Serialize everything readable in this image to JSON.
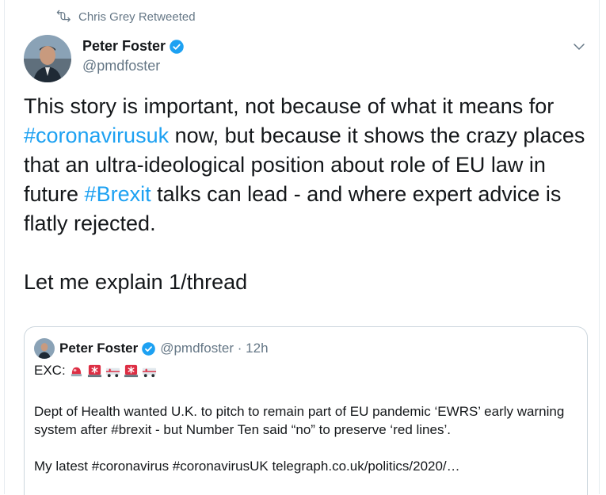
{
  "retweet": {
    "text": "Chris Grey Retweeted"
  },
  "tweet": {
    "author": {
      "name": "Peter Foster",
      "handle": "@pmdfoster"
    },
    "text": {
      "part1": "This story is important, not because of what it means for ",
      "hashtag1": "#coronavirusuk",
      "part2": " now, but because it shows the crazy places that an ultra-ideological position about role of EU law in future ",
      "hashtag2": "#Brexit",
      "part3": " talks can lead - and where expert advice is flatly rejected.",
      "para2": "Let me explain 1/thread"
    }
  },
  "quoted": {
    "author": {
      "name": "Peter Foster",
      "handle": "@pmdfoster",
      "separator": " · ",
      "time": "12h"
    },
    "exc_label": "EXC:",
    "emojis": [
      "rotating-light-emoji",
      "siren-emoji",
      "ambulance-emoji",
      "siren-emoji",
      "ambulance-emoji"
    ],
    "body": "Dept of Health wanted U.K. to pitch to remain part of EU pandemic ‘EWRS’ early warning system after #brexit - but Number Ten said “no” to preserve ‘red lines’.",
    "link_line": "My latest #coronavirus #coronavirusUK  telegraph.co.uk/politics/2020/…"
  },
  "colors": {
    "link": "#1da1f2",
    "secondary": "#657786",
    "border": "#ccd6dd",
    "text": "#14171a"
  }
}
